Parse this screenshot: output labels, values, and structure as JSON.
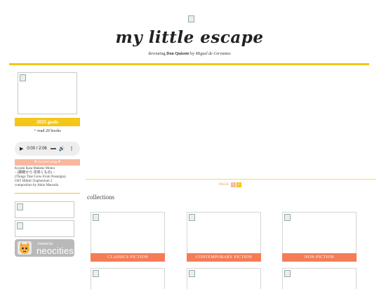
{
  "header": {
    "title": "my little escape",
    "subtitle_prefix": "devouring",
    "book_title": "Don Quixote",
    "subtitle_suffix": "by",
    "author": "Miguel de Cervantes"
  },
  "sidebar": {
    "goals_heading": "2025 goals",
    "goals_items": [
      "+ read 20 books"
    ],
    "audio": {
      "time": "0:00 / 2:06",
      "play_icon": "play-icon",
      "volume_icon": "volume-icon",
      "menu_icon": "more-icon"
    },
    "song_heading": "♥ current song ♥",
    "song_lines": [
      "Kyoshi Kata Mabeke Momo",
      "– (願範から 花咲くもの) –",
      "(Things That Grow From Nostalgia)",
      "OST Hibiki! Euphonium 2",
      "composition by Akito Matsuda"
    ],
    "neocities": {
      "hosted": "hosted by",
      "name": "neocities"
    }
  },
  "pager": {
    "label": "PAGE",
    "pages": [
      "1",
      "2"
    ]
  },
  "collections": {
    "heading": "collections",
    "cards": [
      {
        "label": "CLASSICS FICTION"
      },
      {
        "label": "CONTEMPORARY FICTION"
      },
      {
        "label": "NON-FICTION"
      }
    ]
  },
  "colors": {
    "accent_yellow": "#f5c518",
    "accent_orange": "#f47c56",
    "accent_peach": "#f9b79f"
  }
}
